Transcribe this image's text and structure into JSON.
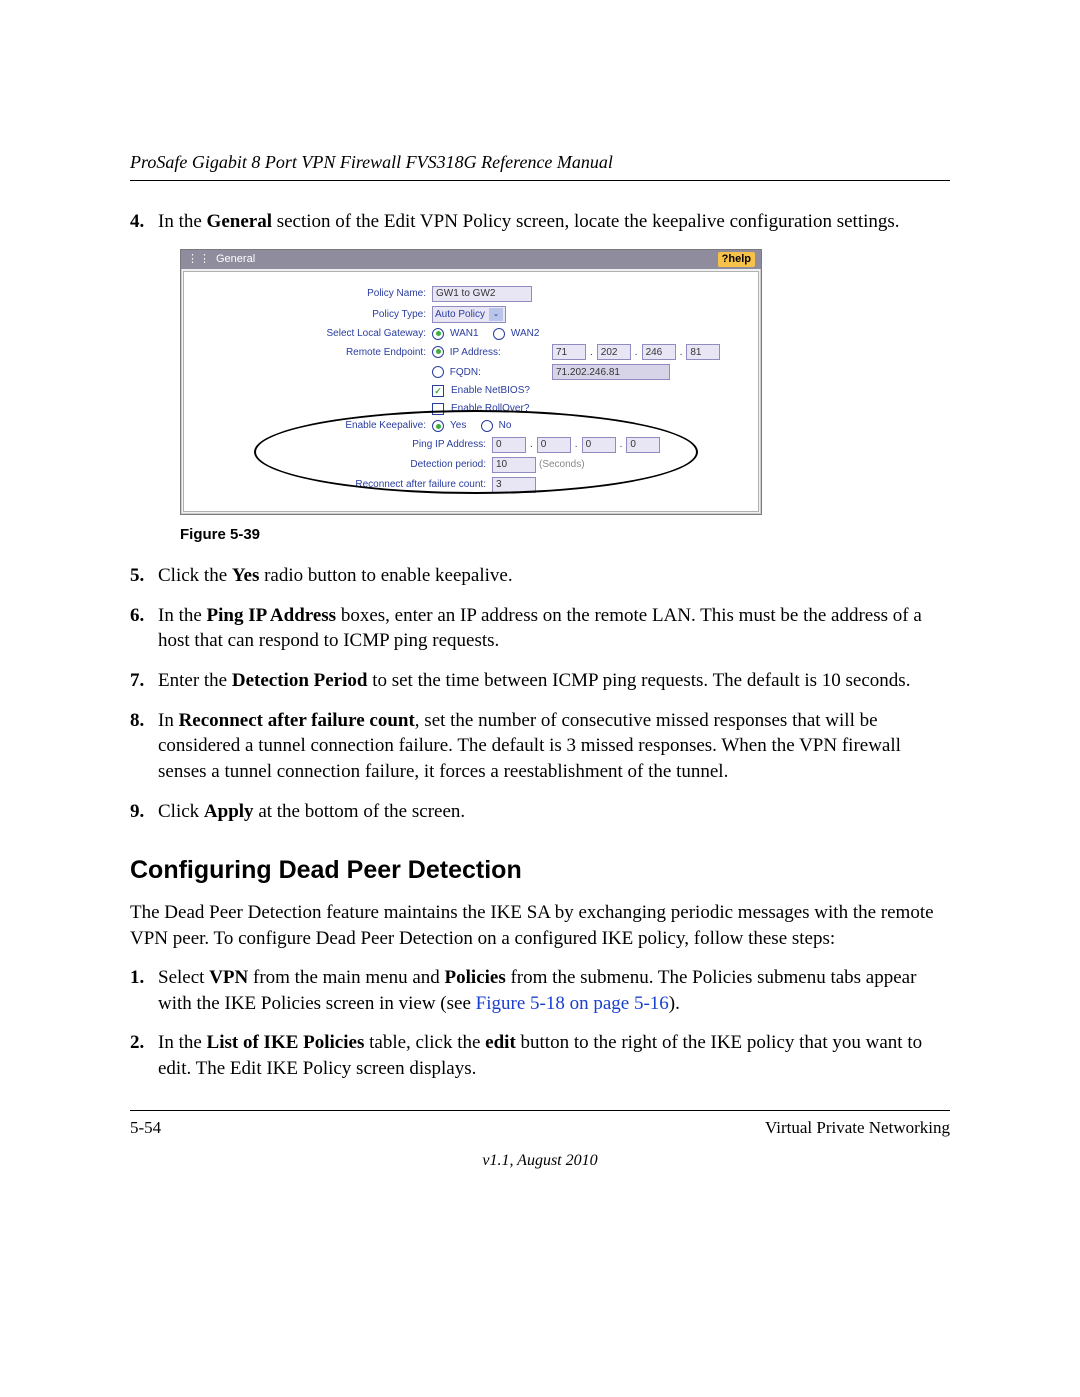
{
  "header": {
    "manual_title": "ProSafe Gigabit 8 Port VPN Firewall FVS318G Reference Manual"
  },
  "steps_a": [
    {
      "num": "4.",
      "html": "In the <b>General</b> section of the Edit VPN Policy screen, locate the keepalive configuration settings."
    }
  ],
  "figure": {
    "caption": "Figure 5-39",
    "panel_title": "General",
    "help_label": "help",
    "labels": {
      "policy_name": "Policy Name:",
      "policy_type": "Policy Type:",
      "select_gw": "Select Local Gateway:",
      "remote_ep": "Remote Endpoint:",
      "ip_addr": "IP Address:",
      "fqdn": "FQDN:",
      "netbios": "Enable NetBIOS?",
      "rollover": "Enable RollOver?",
      "keepalive": "Enable Keepalive:",
      "yes": "Yes",
      "no": "No",
      "ping": "Ping IP Address:",
      "detection": "Detection period:",
      "seconds": "(Seconds)",
      "reconnect": "Reconnect after failure count:",
      "wan1": "WAN1",
      "wan2": "WAN2"
    },
    "values": {
      "policy_name": "GW1 to GW2",
      "policy_type": "Auto Policy",
      "ip": [
        "71",
        "202",
        "246",
        "81"
      ],
      "fqdn": "71.202.246.81",
      "ping": [
        "0",
        "0",
        "0",
        "0"
      ],
      "detection": "10",
      "reconnect": "3"
    }
  },
  "steps_b": [
    {
      "num": "5.",
      "html": "Click the <b>Yes</b> radio button to enable keepalive."
    },
    {
      "num": "6.",
      "html": "In the <b>Ping IP Address</b> boxes, enter an IP address on the remote LAN. This must be the address of a host that can respond to ICMP ping requests."
    },
    {
      "num": "7.",
      "html": "Enter the <b>Detection Period</b> to set the time between ICMP ping requests. The default is 10 seconds."
    },
    {
      "num": "8.",
      "html": "In <b>Reconnect after failure count</b>, set the number of consecutive missed responses that will be considered a tunnel connection failure. The default is 3 missed responses. When the VPN firewall senses a tunnel connection failure, it forces a reestablishment of the tunnel."
    },
    {
      "num": "9.",
      "html": "Click <b>Apply</b> at the bottom of the screen."
    }
  ],
  "section": {
    "heading": "Configuring Dead Peer Detection",
    "intro": "The Dead Peer Detection feature maintains the IKE SA by exchanging periodic messages with the remote VPN peer. To configure Dead Peer Detection on a configured IKE policy, follow these steps:"
  },
  "steps_c": [
    {
      "num": "1.",
      "html": "Select <b>VPN</b> from the main menu and <b>Policies</b> from the submenu. The Policies submenu tabs appear with the IKE Policies screen in view (see <a class=\"xref\" href=\"#\" data-name=\"xref-link\" data-interactable=\"true\">Figure 5-18 on page 5-16</a>)."
    },
    {
      "num": "2.",
      "html": "In the <b>List of IKE Policies</b> table, click the <b>edit</b> button to the right of the IKE policy that you want to edit. The Edit IKE Policy screen displays."
    }
  ],
  "footer": {
    "page": "5-54",
    "chapter": "Virtual Private Networking",
    "version": "v1.1, August 2010"
  }
}
